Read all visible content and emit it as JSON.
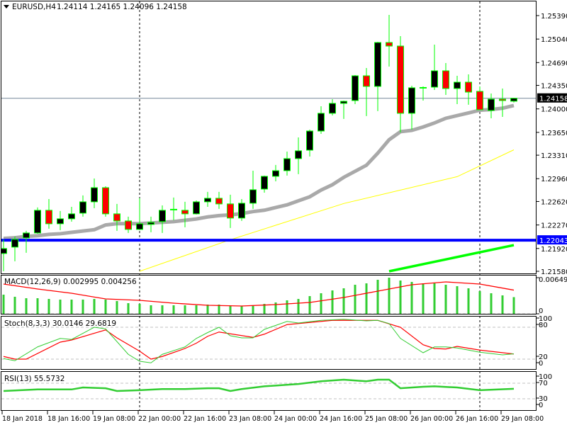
{
  "header": {
    "menu_icon": "triangle-down-icon",
    "symbol": "EURUSD,H4",
    "ohlc": "1.24114 1.24165 1.24096 1.24158"
  },
  "colors": {
    "bull_body": "#000000",
    "bear_body": "#ff0000",
    "candle_outline": "#00ff00",
    "ma_fast": "#a9a9a9",
    "ma_slow": "#ffff00",
    "ma_green": "#00ff00",
    "support_line": "#0000ff",
    "price_line": "#778899",
    "macd_hist": "#32cd32",
    "signal": "#ff0000",
    "stoch_main": "#32cd32",
    "rsi": "#32cd32"
  },
  "chart_data": {
    "type": "candlestick",
    "title": "EURUSD,H4",
    "x_labels": [
      "18 Jan 2018",
      "18 Jan 16:00",
      "19 Jan 08:00",
      "22 Jan 00:00",
      "22 Jan 16:00",
      "23 Jan 08:00",
      "24 Jan 00:00",
      "24 Jan 16:00",
      "25 Jan 08:00",
      "26 Jan 00:00",
      "26 Jan 16:00",
      "29 Jan 08:00"
    ],
    "x_label_every_n_candles": 4,
    "period_separators": [
      12,
      42
    ],
    "ylim": [
      1.2158,
      1.2539
    ],
    "price_ticks": [
      "1.25390",
      "1.25040",
      "1.24690",
      "1.24350",
      "1.24000",
      "1.23650",
      "1.23310",
      "1.22960",
      "1.22620",
      "1.22270",
      "1.21920",
      "1.21580"
    ],
    "current_price": "1.24158",
    "support_level": "1.22043",
    "candles_ohlc": [
      [
        1.21845,
        1.22056,
        1.21581,
        1.21919
      ],
      [
        1.2194,
        1.22098,
        1.21729,
        1.22056
      ],
      [
        1.22077,
        1.22183,
        1.21856,
        1.22151
      ],
      [
        1.22151,
        1.22531,
        1.2214,
        1.22489
      ],
      [
        1.22489,
        1.22657,
        1.22214,
        1.22288
      ],
      [
        1.22288,
        1.22478,
        1.22193,
        1.22362
      ],
      [
        1.22362,
        1.22541,
        1.2232,
        1.22436
      ],
      [
        1.22446,
        1.2271,
        1.22394,
        1.22615
      ],
      [
        1.22615,
        1.22963,
        1.2252,
        1.22826
      ],
      [
        1.22826,
        1.22847,
        1.22394,
        1.22436
      ],
      [
        1.22436,
        1.22584,
        1.22183,
        1.2233
      ],
      [
        1.2233,
        1.22394,
        1.22151,
        1.22204
      ],
      [
        1.22204,
        1.22668,
        1.22193,
        1.22288
      ],
      [
        1.22278,
        1.22394,
        1.22162,
        1.22309
      ],
      [
        1.2232,
        1.22562,
        1.22151,
        1.22489
      ],
      [
        1.22499,
        1.22679,
        1.22341,
        1.22499
      ],
      [
        1.22489,
        1.22615,
        1.22235,
        1.22436
      ],
      [
        1.22436,
        1.22636,
        1.22425,
        1.22615
      ],
      [
        1.22615,
        1.22763,
        1.22541,
        1.22668
      ],
      [
        1.22668,
        1.22763,
        1.2251,
        1.22584
      ],
      [
        1.22584,
        1.22721,
        1.22225,
        1.22373
      ],
      [
        1.22373,
        1.22657,
        1.2233,
        1.22594
      ],
      [
        1.22594,
        1.23079,
        1.2251,
        1.22795
      ],
      [
        1.22805,
        1.23006,
        1.22752,
        1.22995
      ],
      [
        1.22995,
        1.23164,
        1.22921,
        1.23079
      ],
      [
        1.23079,
        1.23364,
        1.23006,
        1.23259
      ],
      [
        1.23259,
        1.23575,
        1.23027,
        1.23375
      ],
      [
        1.23385,
        1.23691,
        1.2329,
        1.2367
      ],
      [
        1.2367,
        1.24039,
        1.23628,
        1.23934
      ],
      [
        1.23934,
        1.24145,
        1.23902,
        1.24082
      ],
      [
        1.24082,
        1.24124,
        1.2385,
        1.24113
      ],
      [
        1.24124,
        1.24504,
        1.24071,
        1.24493
      ],
      [
        1.24493,
        1.24609,
        1.23892,
        1.24335
      ],
      [
        1.24335,
        1.25,
        1.23966,
        1.24989
      ],
      [
        1.24989,
        1.254,
        1.2463,
        1.24936
      ],
      [
        1.24936,
        1.25084,
        1.23649,
        1.23934
      ],
      [
        1.23934,
        1.24345,
        1.23691,
        1.24314
      ],
      [
        1.24314,
        1.24335,
        1.24124,
        1.24314
      ],
      [
        1.24324,
        1.24957,
        1.24282,
        1.24567
      ],
      [
        1.24567,
        1.24683,
        1.24208,
        1.24303
      ],
      [
        1.24303,
        1.24493,
        1.24071,
        1.24398
      ],
      [
        1.24398,
        1.24514,
        1.24061,
        1.2425
      ],
      [
        1.24261,
        1.24335,
        1.23987,
        1.23987
      ],
      [
        1.23976,
        1.24229,
        1.2386,
        1.24145
      ],
      [
        1.24145,
        1.24303,
        1.23881,
        1.24124
      ],
      [
        1.24114,
        1.24165,
        1.24096,
        1.24158
      ]
    ],
    "ma_gray": [
      1.2207,
      1.2208,
      1.221,
      1.2211,
      1.2213,
      1.2214,
      1.2216,
      1.2218,
      1.222,
      1.2227,
      1.2229,
      1.2229,
      1.2229,
      1.223,
      1.2231,
      1.2232,
      1.2234,
      1.2236,
      1.2239,
      1.2241,
      1.2242,
      1.2244,
      1.2247,
      1.2249,
      1.2253,
      1.2257,
      1.2263,
      1.2269,
      1.2279,
      1.2287,
      1.2298,
      1.2307,
      1.2316,
      1.2334,
      1.2354,
      1.2366,
      1.2368,
      1.2373,
      1.2379,
      1.2386,
      1.239,
      1.2394,
      1.2398,
      1.2399,
      1.2401,
      1.2405
    ],
    "ma_yellow_points": [
      [
        12,
        1.2158
      ],
      [
        20,
        1.2205
      ],
      [
        30,
        1.2259
      ],
      [
        40,
        1.2299
      ],
      [
        45,
        1.2339
      ]
    ],
    "ma_green_points": [
      [
        34,
        1.2158
      ],
      [
        45,
        1.2197
      ]
    ],
    "macd": {
      "label": "MACD(12,26,9) 0.002995 0.004256",
      "ylim": [
        0,
        0.006491
      ],
      "ticks": [
        "0.006491",
        "0"
      ],
      "histogram": [
        0.00344,
        0.00306,
        0.0028,
        0.0028,
        0.00267,
        0.00255,
        0.00255,
        0.00255,
        0.00267,
        0.00255,
        0.00229,
        0.00191,
        0.00178,
        0.00153,
        0.00153,
        0.00153,
        0.00153,
        0.00153,
        0.00165,
        0.00165,
        0.0014,
        0.0014,
        0.0014,
        0.00178,
        0.00204,
        0.00242,
        0.00267,
        0.00318,
        0.00369,
        0.0042,
        0.00458,
        0.00522,
        0.00547,
        0.00611,
        0.00649,
        0.00598,
        0.00573,
        0.00547,
        0.00547,
        0.00522,
        0.00496,
        0.00458,
        0.00407,
        0.00369,
        0.00331,
        0.002995
      ],
      "signal_points": [
        [
          0,
          0.00535
        ],
        [
          3,
          0.00446
        ],
        [
          6,
          0.00369
        ],
        [
          9,
          0.00267
        ],
        [
          12,
          0.00242
        ],
        [
          15,
          0.00191
        ],
        [
          18,
          0.00153
        ],
        [
          21,
          0.0014
        ],
        [
          24,
          0.00165
        ],
        [
          27,
          0.00204
        ],
        [
          30,
          0.00293
        ],
        [
          33,
          0.00407
        ],
        [
          36,
          0.00522
        ],
        [
          39,
          0.00573
        ],
        [
          42,
          0.00535
        ],
        [
          45,
          0.004256
        ]
      ]
    },
    "stoch": {
      "label": "Stoch(8,3,3) 30.0146 29.6819",
      "ylim": [
        0,
        100
      ],
      "ticks": [
        "100",
        "80",
        "20",
        "0"
      ],
      "levels": [
        80,
        20
      ],
      "main_points": [
        [
          0,
          21
        ],
        [
          1,
          17
        ],
        [
          3,
          43
        ],
        [
          5,
          59
        ],
        [
          6,
          57
        ],
        [
          8,
          80
        ],
        [
          9,
          77
        ],
        [
          11,
          29
        ],
        [
          12,
          16
        ],
        [
          13,
          13
        ],
        [
          14,
          29
        ],
        [
          16,
          43
        ],
        [
          17,
          59
        ],
        [
          18,
          70
        ],
        [
          19,
          80
        ],
        [
          20,
          64
        ],
        [
          21,
          60
        ],
        [
          22,
          60
        ],
        [
          23,
          76
        ],
        [
          25,
          91
        ],
        [
          26,
          88
        ],
        [
          28,
          93
        ],
        [
          30,
          95
        ],
        [
          32,
          92
        ],
        [
          33,
          93
        ],
        [
          34,
          87
        ],
        [
          35,
          59
        ],
        [
          37,
          32
        ],
        [
          38,
          43
        ],
        [
          39,
          43
        ],
        [
          40,
          41
        ],
        [
          42,
          33
        ],
        [
          44,
          28
        ],
        [
          45,
          30.0146
        ]
      ],
      "signal_points": [
        [
          0,
          25
        ],
        [
          1,
          20
        ],
        [
          2,
          20
        ],
        [
          5,
          52
        ],
        [
          6,
          56
        ],
        [
          9,
          75
        ],
        [
          10,
          60
        ],
        [
          12,
          35
        ],
        [
          13,
          20
        ],
        [
          14,
          25
        ],
        [
          16,
          40
        ],
        [
          17,
          50
        ],
        [
          18,
          63
        ],
        [
          19,
          71
        ],
        [
          22,
          61
        ],
        [
          23,
          67
        ],
        [
          25,
          85
        ],
        [
          29,
          93
        ],
        [
          33,
          93
        ],
        [
          35,
          80
        ],
        [
          37,
          47
        ],
        [
          38,
          40
        ],
        [
          39,
          39
        ],
        [
          40,
          44
        ],
        [
          42,
          37
        ],
        [
          45,
          29.6819
        ]
      ]
    },
    "rsi": {
      "label": "RSI(13) 55.5732",
      "ylim": [
        0,
        100
      ],
      "ticks": [
        "100",
        "70",
        "30",
        "0"
      ],
      "levels": [
        70,
        30
      ],
      "points": [
        [
          0,
          50
        ],
        [
          3,
          54
        ],
        [
          6,
          54
        ],
        [
          7,
          59
        ],
        [
          9,
          57
        ],
        [
          10,
          50
        ],
        [
          12,
          52
        ],
        [
          14,
          55
        ],
        [
          16,
          55
        ],
        [
          18,
          57
        ],
        [
          19,
          57
        ],
        [
          20,
          50
        ],
        [
          21,
          55
        ],
        [
          23,
          62
        ],
        [
          26,
          68
        ],
        [
          28,
          75
        ],
        [
          30,
          79
        ],
        [
          32,
          75
        ],
        [
          33,
          79
        ],
        [
          34,
          79
        ],
        [
          35,
          57
        ],
        [
          37,
          61
        ],
        [
          38,
          62
        ],
        [
          40,
          59
        ],
        [
          42,
          52
        ],
        [
          45,
          55.5732
        ]
      ]
    }
  }
}
